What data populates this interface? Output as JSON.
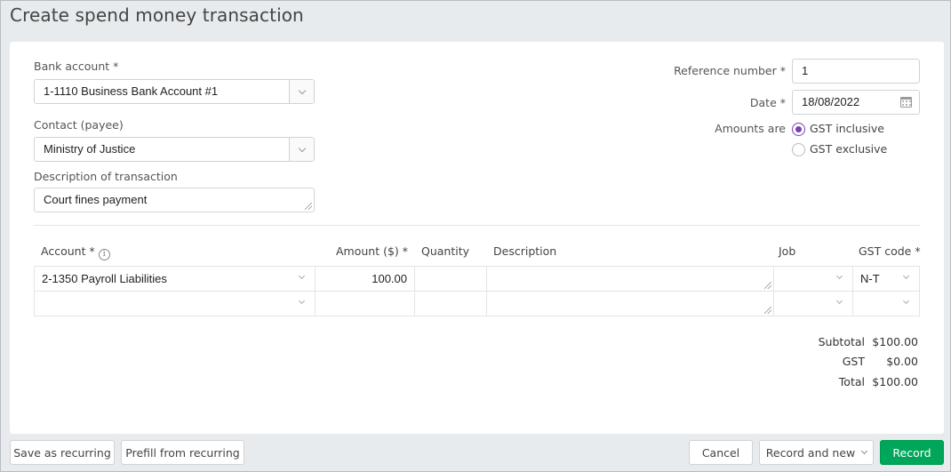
{
  "page": {
    "title": "Create spend money transaction"
  },
  "form": {
    "bank_account": {
      "label": "Bank account *",
      "value": "1-1110 Business Bank Account #1"
    },
    "contact": {
      "label": "Contact (payee)",
      "value": "Ministry of Justice"
    },
    "description": {
      "label": "Description of transaction",
      "value": "Court fines payment"
    },
    "reference": {
      "label": "Reference number *",
      "value": "1"
    },
    "date": {
      "label": "Date *",
      "value": "18/08/2022"
    },
    "amounts_are": {
      "label": "Amounts are",
      "options": [
        {
          "label": "GST inclusive",
          "selected": true
        },
        {
          "label": "GST exclusive",
          "selected": false
        }
      ]
    }
  },
  "table": {
    "headers": {
      "account": "Account *",
      "amount": "Amount ($) *",
      "quantity": "Quantity",
      "description": "Description",
      "job": "Job",
      "gst_code": "GST code *"
    },
    "rows": [
      {
        "account": "2-1350 Payroll Liabilities",
        "amount": "100.00",
        "quantity": "",
        "description": "",
        "job": "",
        "gst_code": "N-T"
      },
      {
        "account": "",
        "amount": "",
        "quantity": "",
        "description": "",
        "job": "",
        "gst_code": ""
      }
    ]
  },
  "totals": {
    "subtotal_label": "Subtotal",
    "subtotal": "$100.00",
    "gst_label": "GST",
    "gst": "$0.00",
    "total_label": "Total",
    "total": "$100.00"
  },
  "footer": {
    "save_recurring": "Save as recurring",
    "prefill_recurring": "Prefill from recurring",
    "cancel": "Cancel",
    "record_and_new": "Record and new",
    "record": "Record"
  },
  "colors": {
    "accent": "#7b3fb0",
    "primary_button": "#00a65a"
  }
}
